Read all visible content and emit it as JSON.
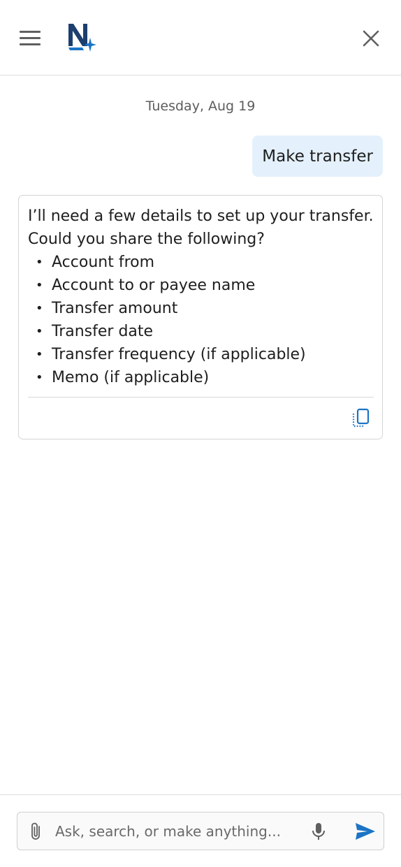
{
  "header": {
    "menu_icon": "hamburger-menu-icon",
    "logo_letter": "N",
    "close_icon": "close-icon"
  },
  "chat": {
    "date": "Tuesday, Aug 19",
    "user_message": "Make transfer",
    "bot": {
      "intro": "I’ll need a few details to set up your transfer. Could you share the following?",
      "items": [
        "Account from",
        "Account to or payee name",
        "Transfer amount",
        "Transfer date",
        "Transfer frequency (if applicable)",
        "Memo (if applicable)"
      ],
      "copy_icon": "copy-icon"
    }
  },
  "composer": {
    "placeholder": "Ask, search, or make anything...",
    "value": "",
    "attach_icon": "paperclip-icon",
    "mic_icon": "microphone-icon",
    "send_icon": "send-icon"
  },
  "colors": {
    "brand_navy": "#1d3f6e",
    "brand_blue": "#1b74c5",
    "user_bubble": "#e4f1fc",
    "border": "#d4d4d4"
  }
}
